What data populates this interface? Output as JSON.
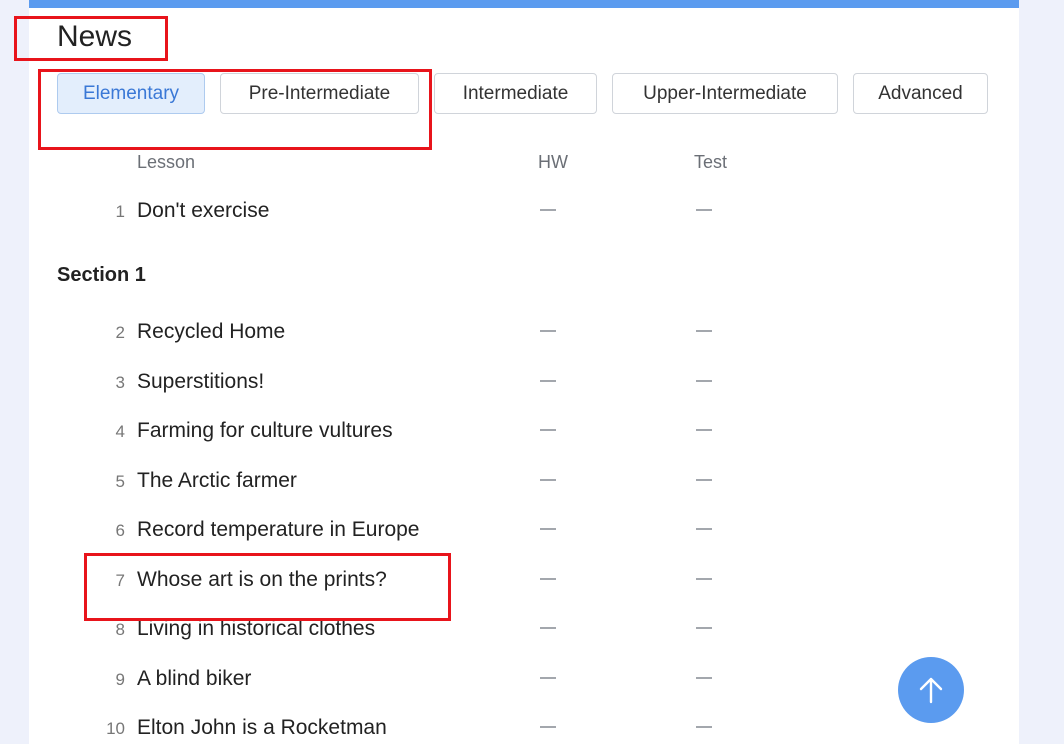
{
  "page": {
    "title": "News"
  },
  "tabs": [
    {
      "label": "Elementary",
      "active": true
    },
    {
      "label": "Pre-Intermediate",
      "active": false
    },
    {
      "label": "Intermediate",
      "active": false
    },
    {
      "label": "Upper-Intermediate",
      "active": false
    },
    {
      "label": "Advanced",
      "active": false
    }
  ],
  "columns": {
    "lesson": "Lesson",
    "hw": "HW",
    "test": "Test"
  },
  "intro_lessons": [
    {
      "num": "1",
      "title": "Don't exercise"
    }
  ],
  "section": {
    "title": "Section 1"
  },
  "section_lessons": [
    {
      "num": "2",
      "title": "Recycled Home"
    },
    {
      "num": "3",
      "title": "Superstitions!"
    },
    {
      "num": "4",
      "title": "Farming for culture vultures"
    },
    {
      "num": "5",
      "title": "The Arctic farmer"
    },
    {
      "num": "6",
      "title": "Record temperature in Europe"
    },
    {
      "num": "7",
      "title": "Whose art is on the prints?"
    },
    {
      "num": "8",
      "title": "Living in historical clothes"
    },
    {
      "num": "9",
      "title": "A blind biker"
    },
    {
      "num": "10",
      "title": "Elton John is a Rocketman"
    }
  ],
  "colors": {
    "accent": "#5b9bef",
    "highlight": "#e8141b",
    "active_tab_bg": "#e3eefc"
  },
  "icons": {
    "scroll_top": "arrow-up-icon",
    "status": "dash-icon"
  }
}
